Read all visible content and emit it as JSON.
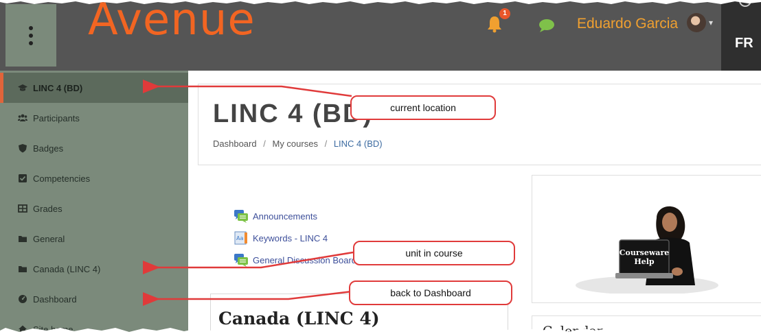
{
  "header": {
    "logo": "Avenue",
    "notification_count": "1",
    "user_name": "Eduardo Garcia",
    "caret": "▾",
    "language": "FR"
  },
  "sidebar": {
    "items": [
      {
        "label": "LINC 4 (BD)",
        "icon": "graduation-cap-icon",
        "active": true
      },
      {
        "label": "Participants",
        "icon": "users-icon"
      },
      {
        "label": "Badges",
        "icon": "shield-icon"
      },
      {
        "label": "Competencies",
        "icon": "checkbox-icon"
      },
      {
        "label": "Grades",
        "icon": "table-icon"
      },
      {
        "label": "General",
        "icon": "folder-icon"
      },
      {
        "label": "Canada (LINC 4)",
        "icon": "folder-icon"
      },
      {
        "label": "Dashboard",
        "icon": "dashboard-icon"
      },
      {
        "label": "Site home",
        "icon": "home-icon"
      }
    ]
  },
  "main": {
    "course_title": "LINC 4 (BD)",
    "breadcrumb": [
      "Dashboard",
      "My courses",
      "LINC 4 (BD)"
    ],
    "breadcrumb_separator": "/",
    "activities": [
      {
        "label": "Announcements",
        "icon": "forum-icon"
      },
      {
        "label": "Keywords - LINC 4",
        "icon": "glossary-icon"
      },
      {
        "label": "General Discussion Board",
        "icon": "forum-icon"
      }
    ],
    "section_title": "Canada (LINC 4)",
    "help_image_text": "Courseware Help",
    "calendar_title": "Calendar"
  },
  "callouts": {
    "current_location": "current location",
    "unit_in_course": "unit in course",
    "back_to_dashboard": "back to Dashboard"
  },
  "colors": {
    "accent_orange": "#f26522",
    "header_bg": "#555555",
    "sidebar_bg": "#7b8a7b",
    "callout_border": "#e03a3a",
    "link_blue": "#3d4f9a"
  }
}
